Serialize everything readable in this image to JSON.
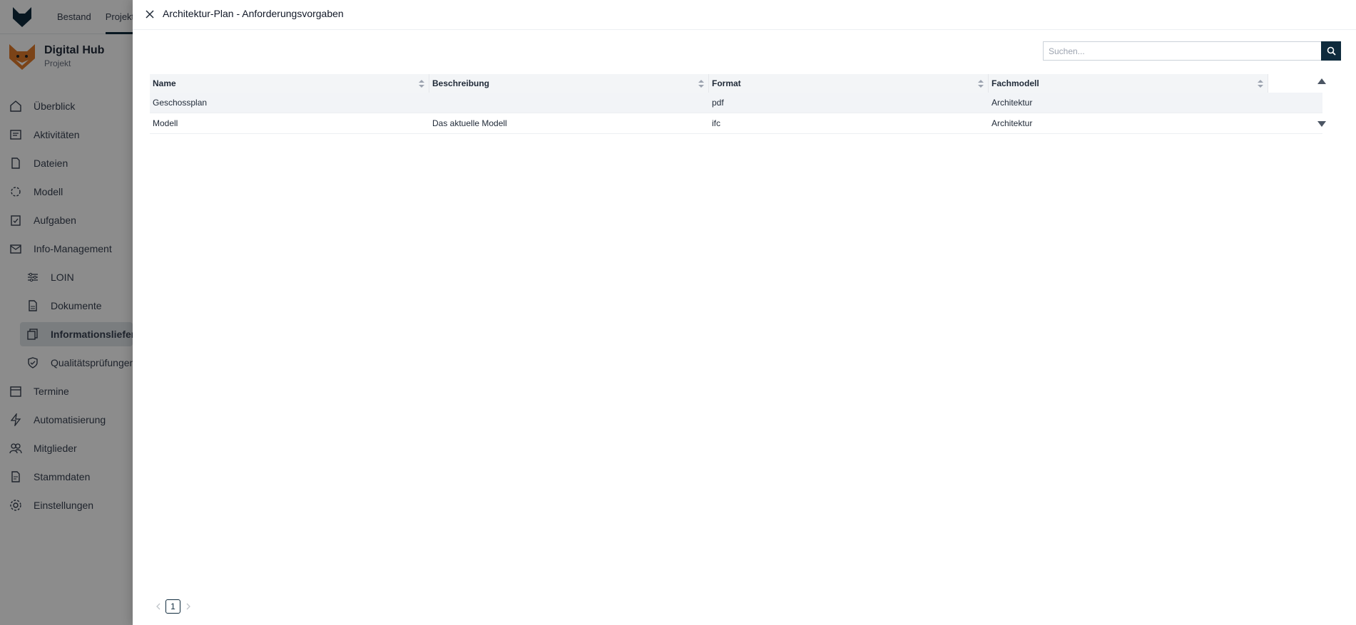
{
  "app": {
    "top_nav": [
      "Bestand",
      "Projekte"
    ],
    "brand_title": "Digital Hub",
    "brand_sub": "Projekt",
    "sidebar": [
      {
        "label": "Überblick",
        "icon": "home-icon"
      },
      {
        "label": "Aktivitäten",
        "icon": "activity-icon"
      },
      {
        "label": "Dateien",
        "icon": "file-icon"
      },
      {
        "label": "Modell",
        "icon": "model-icon"
      },
      {
        "label": "Aufgaben",
        "icon": "tasks-icon"
      },
      {
        "label": "Info-Management",
        "icon": "mail-icon"
      },
      {
        "label": "LOIN",
        "icon": "sliders-icon"
      },
      {
        "label": "Dokumente",
        "icon": "document-icon"
      },
      {
        "label": "Informationslieferungen",
        "icon": "delivery-icon"
      },
      {
        "label": "Qualitätsprüfungen",
        "icon": "shield-check-icon"
      },
      {
        "label": "Termine",
        "icon": "calendar-icon"
      },
      {
        "label": "Automatisierung",
        "icon": "bolt-icon"
      },
      {
        "label": "Mitglieder",
        "icon": "users-icon"
      },
      {
        "label": "Stammdaten",
        "icon": "data-file-icon"
      },
      {
        "label": "Einstellungen",
        "icon": "gear-icon"
      }
    ]
  },
  "drawer": {
    "title": "Architektur-Plan - Anforderungsvorgaben",
    "search_placeholder": "Suchen...",
    "columns": [
      "Name",
      "Beschreibung",
      "Format",
      "Fachmodell"
    ],
    "rows": [
      {
        "name": "Geschossplan",
        "beschreibung": "",
        "format": "pdf",
        "fachmodell": "Architektur"
      },
      {
        "name": "Modell",
        "beschreibung": "Das aktuelle Modell",
        "format": "ifc",
        "fachmodell": "Architektur"
      }
    ],
    "page": "1"
  },
  "colors": {
    "accent": "#0f2b3d",
    "overlay": "rgba(0,0,0,0.45)"
  }
}
